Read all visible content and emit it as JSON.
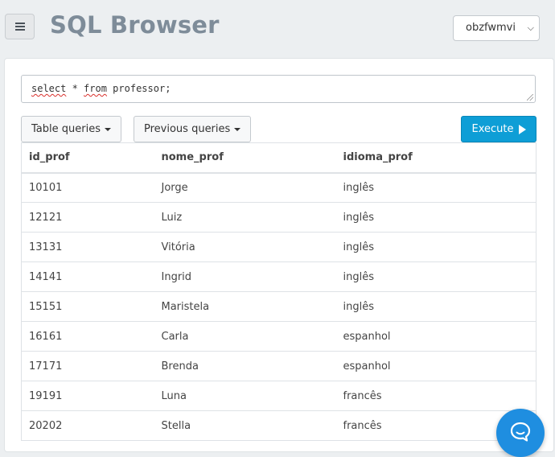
{
  "header": {
    "title": "SQL Browser",
    "database": "obzfwmvi",
    "icons": {
      "menu": "hamburger-menu-icon",
      "select": "chevron-down-icon"
    }
  },
  "query": {
    "kw_select": "select",
    "mid": " * ",
    "kw_from": "from",
    "rest": " professor;"
  },
  "toolbar": {
    "table_queries_label": "Table queries",
    "previous_queries_label": "Previous queries",
    "execute_label": "Execute"
  },
  "results": {
    "columns": [
      "id_prof",
      "nome_prof",
      "idioma_prof"
    ],
    "rows": [
      [
        "10101",
        "Jorge",
        "inglês"
      ],
      [
        "12121",
        "Luiz",
        "inglês"
      ],
      [
        "13131",
        "Vitória",
        "inglês"
      ],
      [
        "14141",
        "Ingrid",
        "inglês"
      ],
      [
        "15151",
        "Maristela",
        "inglês"
      ],
      [
        "16161",
        "Carla",
        "espanhol"
      ],
      [
        "17171",
        "Brenda",
        "espanhol"
      ],
      [
        "19191",
        "Luna",
        "francês"
      ],
      [
        "20202",
        "Stella",
        "francês"
      ]
    ]
  },
  "colors": {
    "accent": "#0e9ed6",
    "title": "#7e8c99",
    "chat": "#1f8ee0"
  }
}
